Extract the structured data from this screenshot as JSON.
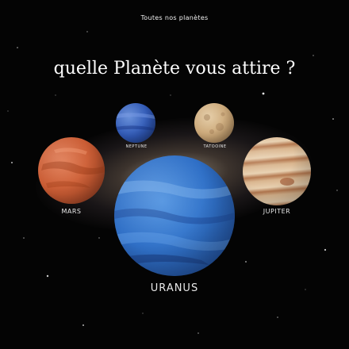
{
  "nav": {
    "link": "Toutes nos planètes"
  },
  "title": "quelle Planète vous attire ?",
  "planets": {
    "neptune": "NEPTUNE",
    "tatooine": "TATOOINE",
    "mars": "MARS",
    "jupiter": "JUPITER",
    "uranus": "URANUS"
  },
  "colors": {
    "background": "#040404",
    "text": "#ffffff",
    "mars": "#c85a32",
    "jupiter": "#d9b58e",
    "neptune": "#2f57b3",
    "tatooine": "#c9a576",
    "uranus": "#2f6fc6"
  }
}
